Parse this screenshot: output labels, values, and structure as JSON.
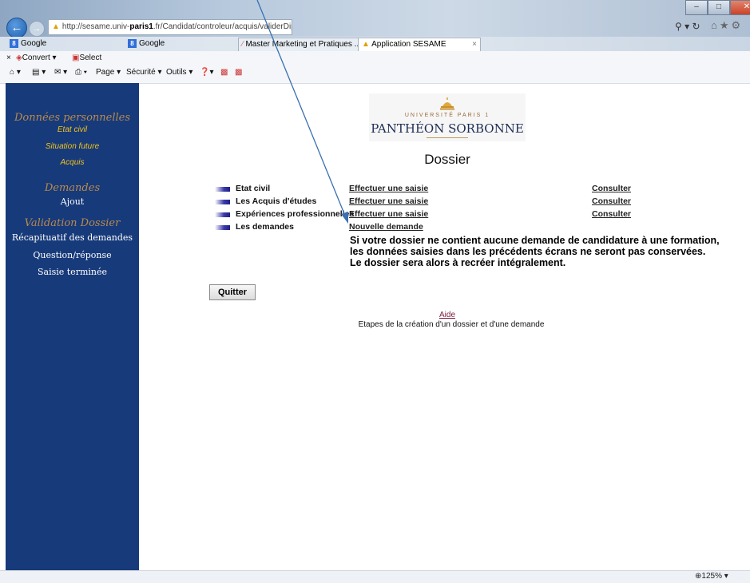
{
  "browser": {
    "url_prefix": "http://sesame.univ-",
    "url_bold": "paris1",
    "url_suffix": ".fr/Candidat/controleur/acquis/validerDiplomes",
    "favorites": [
      "Google",
      "Google"
    ],
    "tabs": [
      "Master Marketing et Pratiques ...",
      "Application SESAME"
    ],
    "tab_close": "×",
    "convert_label": "Convert",
    "select_label": "Select",
    "page_menu": "Page",
    "security_menu": "Sécurité",
    "tools_menu": "Outils",
    "zoom": "125%"
  },
  "sidebar": {
    "section1_title": "Données personnelles",
    "section1_items": [
      "Etat civil",
      "Situation future",
      "Acquis"
    ],
    "section2_title": "Demandes",
    "section2_items": [
      "Ajout"
    ],
    "section3_title": "Validation Dossier",
    "section3_items": [
      "Récapituatif des demandes",
      "Question/réponse",
      "Saisie terminée"
    ]
  },
  "logo": {
    "small": "UNIVERSITÉ PARIS 1",
    "big": "PANTHÉON SORBONNE"
  },
  "main": {
    "title": "Dossier",
    "rows": [
      {
        "label": "Etat civil",
        "action": "Effectuer une saisie",
        "consult": "Consulter"
      },
      {
        "label": "Les Acquis d'études",
        "action": "Effectuer une saisie",
        "consult": "Consulter"
      },
      {
        "label": "Expériences professionnelles",
        "action": "Effectuer une saisie",
        "consult": "Consulter"
      },
      {
        "label": "Les demandes",
        "action": "Nouvelle demande",
        "consult": ""
      }
    ],
    "warning_line1": "Si votre dossier ne contient aucune demande de candidature à une formation,",
    "warning_line2": "les données saisies dans les précédents écrans ne seront pas conservées.",
    "warning_line3": "Le dossier sera alors à recréer intégralement.",
    "quit_label": "Quitter",
    "help_link": "Aide",
    "help_desc": "Etapes de la création d'un dossier et d'une demande"
  },
  "colors": {
    "sidebar_bg": "#173a7a",
    "sidebar_heading": "#b98a4e",
    "sidebar_link": "#f3c21a",
    "annotation_arrow": "#3a6fb0"
  }
}
